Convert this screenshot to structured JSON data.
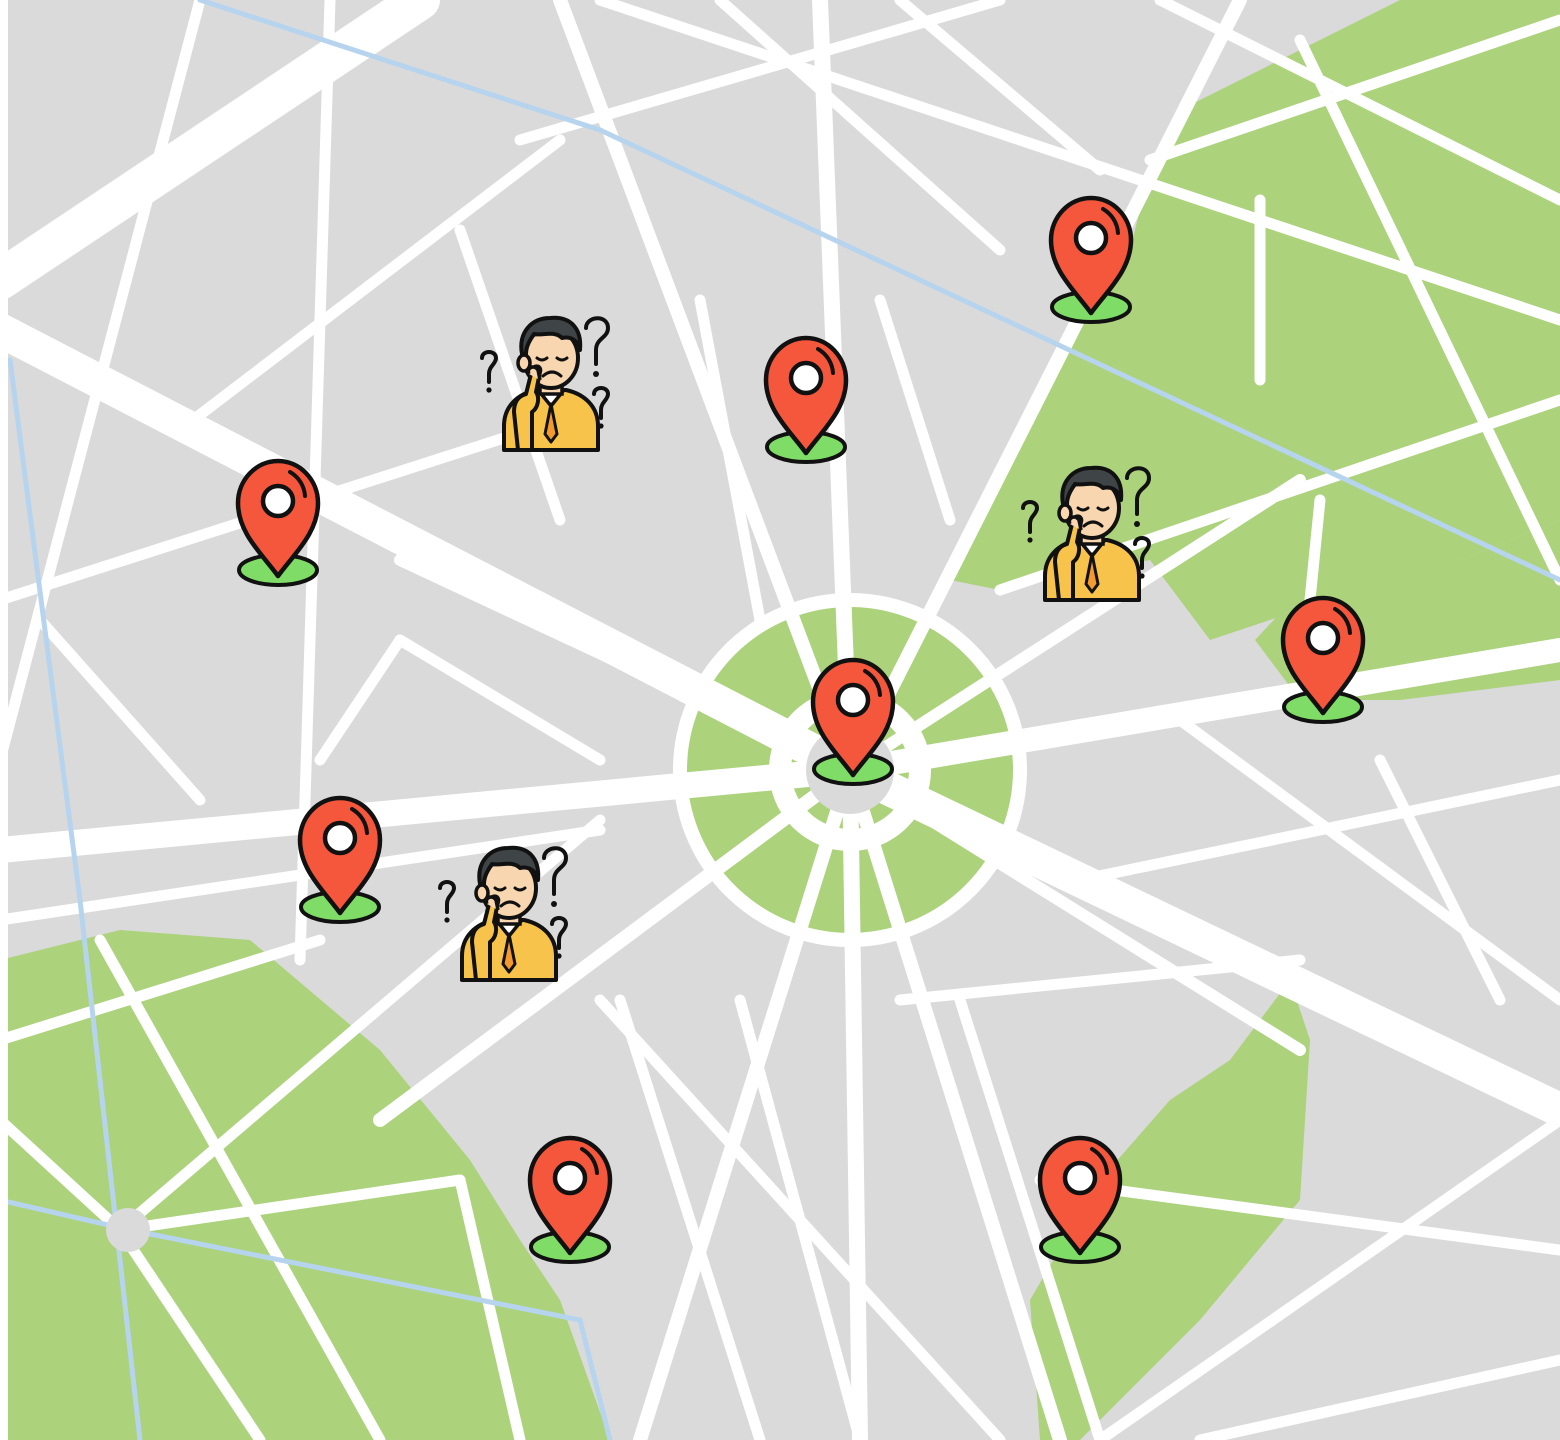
{
  "map": {
    "colors": {
      "block": "#dadada",
      "road": "#ffffff",
      "park": "#acd27c",
      "river": "#b7d4ee",
      "pin_fill": "#f4573b",
      "pin_base": "#7fdc66",
      "outline": "#111111",
      "shirt": "#f8c34a",
      "skin": "#f7d6b0",
      "hair": "#3f4446"
    },
    "markers": [
      {
        "id": "pin-1",
        "icon": "location-pin-icon"
      },
      {
        "id": "pin-2",
        "icon": "location-pin-icon"
      },
      {
        "id": "pin-3",
        "icon": "location-pin-icon"
      },
      {
        "id": "pin-4",
        "icon": "location-pin-icon"
      },
      {
        "id": "pin-5",
        "icon": "location-pin-icon"
      },
      {
        "id": "pin-6",
        "icon": "location-pin-icon"
      },
      {
        "id": "pin-7",
        "icon": "location-pin-icon"
      },
      {
        "id": "pin-8",
        "icon": "location-pin-icon"
      }
    ],
    "confused_people": [
      {
        "id": "person-1",
        "icon": "confused-person-icon"
      },
      {
        "id": "person-2",
        "icon": "confused-person-icon"
      },
      {
        "id": "person-3",
        "icon": "confused-person-icon"
      }
    ]
  }
}
